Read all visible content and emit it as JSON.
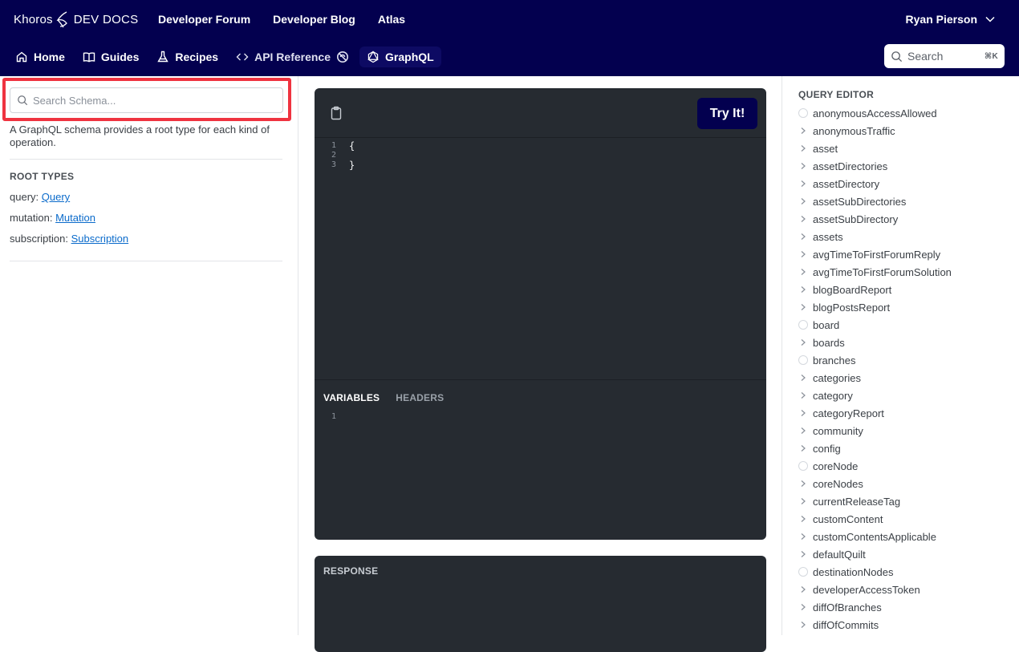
{
  "header": {
    "brand": "Khoros",
    "brand_suffix": "DEV DOCS",
    "links": [
      "Developer Forum",
      "Developer Blog",
      "Atlas"
    ],
    "user_name": "Ryan Pierson",
    "search_placeholder": "Search",
    "search_shortcut": "⌘K"
  },
  "subnav": [
    {
      "label": "Home",
      "icon": "home-icon"
    },
    {
      "label": "Guides",
      "icon": "book-icon"
    },
    {
      "label": "Recipes",
      "icon": "flask-icon"
    },
    {
      "label": "API Reference",
      "icon": "code-icon"
    },
    {
      "label": "GraphQL",
      "icon": "graphql-icon",
      "active": true
    }
  ],
  "left": {
    "search_placeholder": "Search Schema...",
    "description": "A GraphQL schema provides a root type for each kind of operation.",
    "root_title": "ROOT TYPES",
    "roots": [
      {
        "label": "query: ",
        "link": "Query"
      },
      {
        "label": "mutation: ",
        "link": "Mutation"
      },
      {
        "label": "subscription: ",
        "link": "Subscription"
      }
    ]
  },
  "editor": {
    "try_label": "Try It!",
    "code_lines": [
      {
        "num": "1",
        "text": "{"
      },
      {
        "num": "2",
        "text": ""
      },
      {
        "num": "3",
        "text": "}"
      }
    ],
    "tabs": [
      "VARIABLES",
      "HEADERS"
    ],
    "variables_line": "1",
    "response_label": "RESPONSE"
  },
  "query_editor": {
    "title": "QUERY EDITOR",
    "fields": [
      {
        "name": "anonymousAccessAllowed",
        "expandable": false
      },
      {
        "name": "anonymousTraffic",
        "expandable": true
      },
      {
        "name": "asset",
        "expandable": true
      },
      {
        "name": "assetDirectories",
        "expandable": true
      },
      {
        "name": "assetDirectory",
        "expandable": true
      },
      {
        "name": "assetSubDirectories",
        "expandable": true
      },
      {
        "name": "assetSubDirectory",
        "expandable": true
      },
      {
        "name": "assets",
        "expandable": true
      },
      {
        "name": "avgTimeToFirstForumReply",
        "expandable": true
      },
      {
        "name": "avgTimeToFirstForumSolution",
        "expandable": true
      },
      {
        "name": "blogBoardReport",
        "expandable": true
      },
      {
        "name": "blogPostsReport",
        "expandable": true
      },
      {
        "name": "board",
        "expandable": false
      },
      {
        "name": "boards",
        "expandable": true
      },
      {
        "name": "branches",
        "expandable": false
      },
      {
        "name": "categories",
        "expandable": true
      },
      {
        "name": "category",
        "expandable": true
      },
      {
        "name": "categoryReport",
        "expandable": true
      },
      {
        "name": "community",
        "expandable": true
      },
      {
        "name": "config",
        "expandable": true
      },
      {
        "name": "coreNode",
        "expandable": false
      },
      {
        "name": "coreNodes",
        "expandable": true
      },
      {
        "name": "currentReleaseTag",
        "expandable": true
      },
      {
        "name": "customContent",
        "expandable": true
      },
      {
        "name": "customContentsApplicable",
        "expandable": true
      },
      {
        "name": "defaultQuilt",
        "expandable": true
      },
      {
        "name": "destinationNodes",
        "expandable": false
      },
      {
        "name": "developerAccessToken",
        "expandable": true
      },
      {
        "name": "diffOfBranches",
        "expandable": true
      },
      {
        "name": "diffOfCommits",
        "expandable": true
      }
    ]
  },
  "colors": {
    "header_bg": "#03004f",
    "editor_bg": "#262b31",
    "highlight": "#ef3340",
    "link": "#0b6bcb"
  }
}
